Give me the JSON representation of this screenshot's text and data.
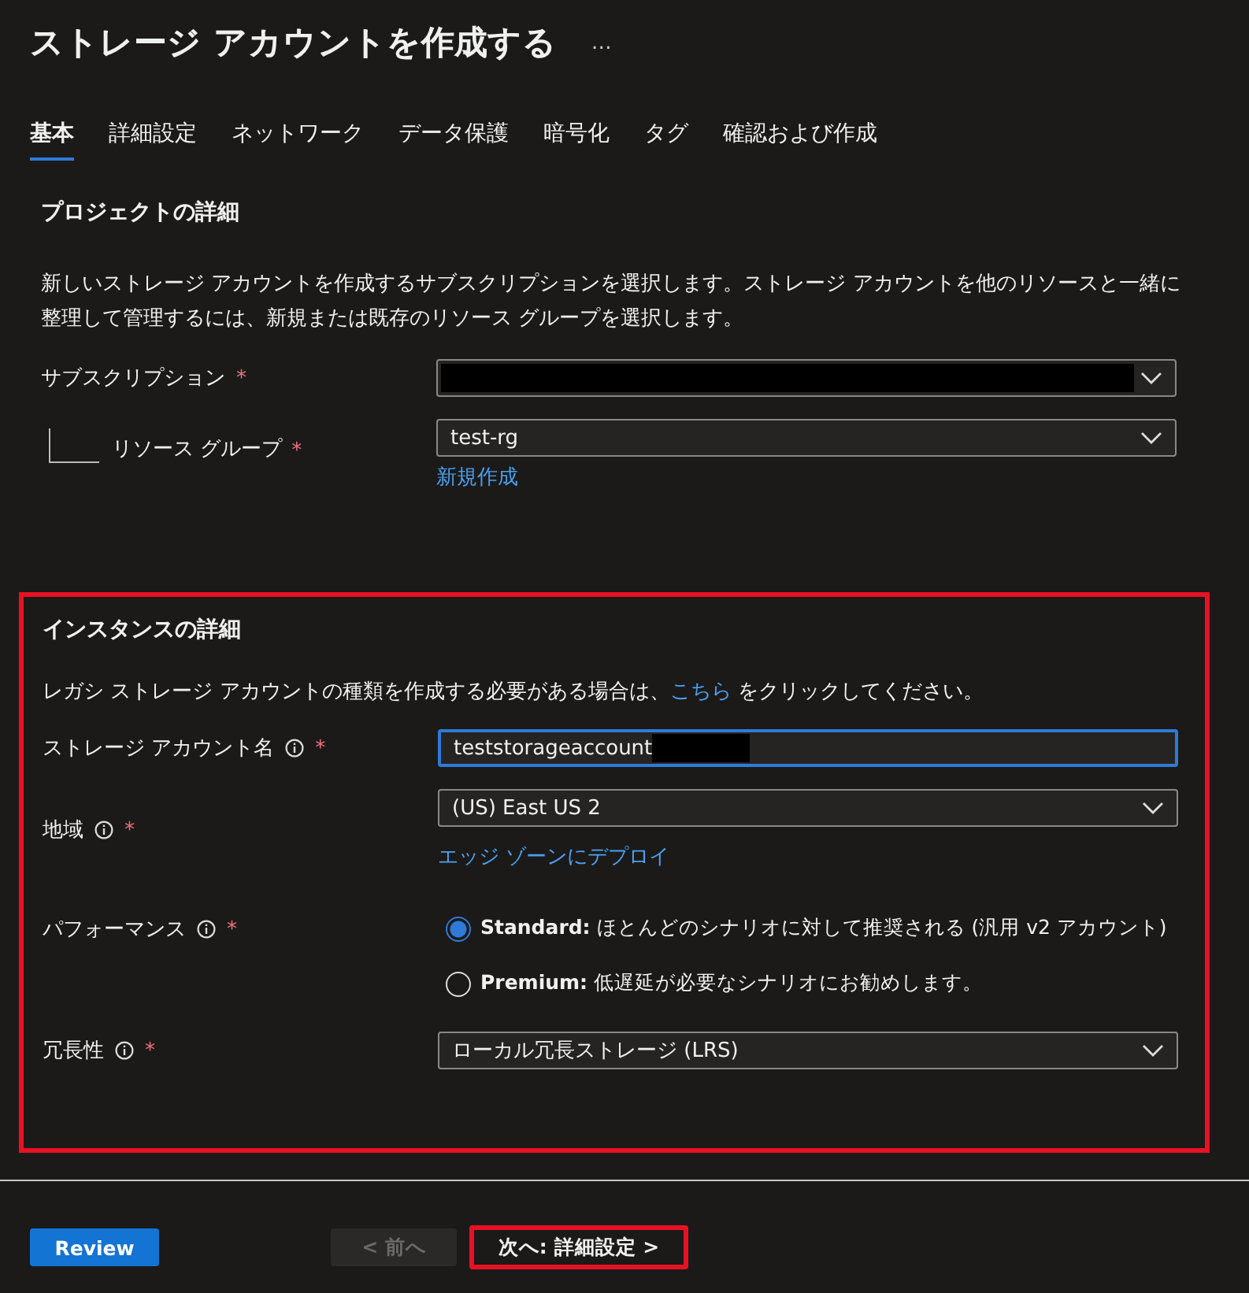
{
  "header": {
    "title": "ストレージ アカウントを作成する",
    "more": "…"
  },
  "tabs": [
    {
      "label": "基本",
      "selected": true
    },
    {
      "label": "詳細設定",
      "selected": false
    },
    {
      "label": "ネットワーク",
      "selected": false
    },
    {
      "label": "データ保護",
      "selected": false
    },
    {
      "label": "暗号化",
      "selected": false
    },
    {
      "label": "タグ",
      "selected": false
    },
    {
      "label": "確認および作成",
      "selected": false
    }
  ],
  "project": {
    "heading": "プロジェクトの詳細",
    "description": "新しいストレージ アカウントを作成するサブスクリプションを選択します。ストレージ アカウントを他のリソースと一緒に整理して管理するには、新規または既存のリソース グループを選択します。",
    "subscription": {
      "label": "サブスクリプション",
      "required": "*",
      "redacted": true
    },
    "resource_group": {
      "label": "リソース グループ",
      "required": "*",
      "value": "test-rg",
      "link": "新規作成"
    }
  },
  "instance": {
    "heading": "インスタンスの詳細",
    "highlighted": true,
    "legacy_text_before": "レガシ ストレージ アカウントの種類を作成する必要がある場合は、",
    "legacy_link": "こちら",
    "legacy_text_after": "をクリックしてください。",
    "account_name": {
      "label": "ストレージ アカウント名",
      "required": "*",
      "value": "teststorageaccount",
      "redacted": true,
      "focused": true
    },
    "region": {
      "label": "地域",
      "required": "*",
      "value": "(US) East US 2",
      "link": "エッジ ゾーンにデプロイ"
    },
    "performance": {
      "label": "パフォーマンス",
      "required": "*",
      "options": [
        {
          "name": "Standard:",
          "text": "ほとんどのシナリオに対して推奨される (汎用 v2 アカウント)",
          "selected": true
        },
        {
          "name": "Premium:",
          "text": "低遅延が必要なシナリオにお勧めします。",
          "selected": false
        }
      ]
    },
    "redundancy": {
      "label": "冗長性",
      "required": "*",
      "value": "ローカル冗長ストレージ (LRS)"
    }
  },
  "footer": {
    "review": "Review",
    "previous": {
      "label": "< 前へ",
      "disabled": true
    },
    "next": {
      "label": "次へ: 詳細設定 >",
      "highlighted": true
    }
  }
}
